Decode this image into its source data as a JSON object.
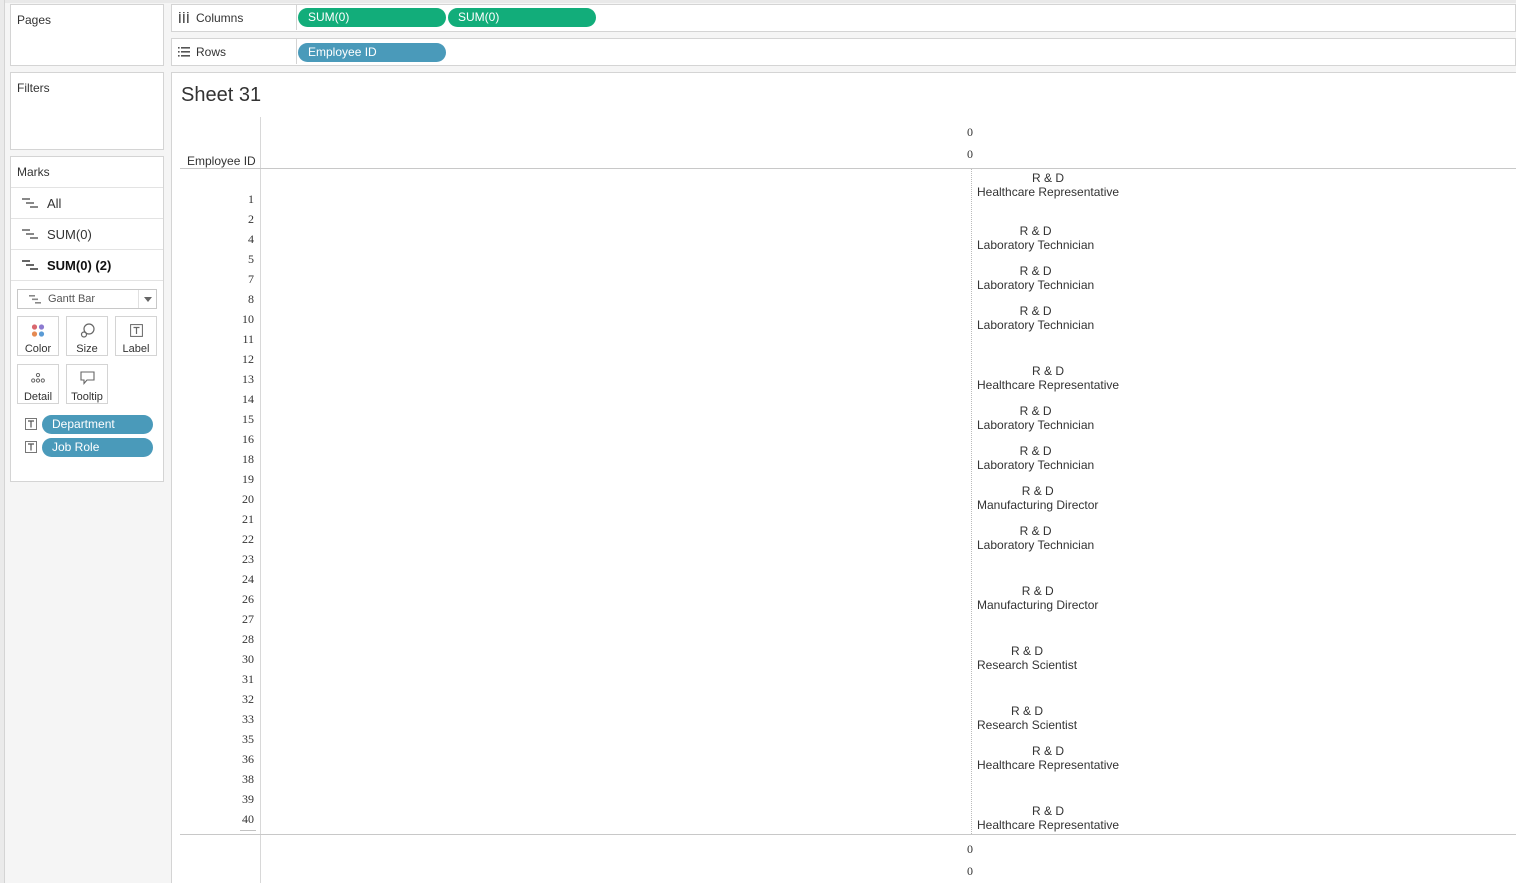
{
  "pages_card": {
    "title": "Pages"
  },
  "filters_card": {
    "title": "Filters"
  },
  "marks_card": {
    "title": "Marks",
    "rows": [
      {
        "label": "All"
      },
      {
        "label": "SUM(0)"
      },
      {
        "label": "SUM(0) (2)"
      }
    ],
    "mark_type": "Gantt Bar",
    "buttons": {
      "color": "Color",
      "size": "Size",
      "label": "Label",
      "detail": "Detail",
      "tooltip": "Tooltip"
    },
    "fields": [
      {
        "label": "Department",
        "type_icon": "T"
      },
      {
        "label": "Job Role",
        "type_icon": "T"
      }
    ]
  },
  "columns_shelf": {
    "label": "Columns",
    "pills": [
      "SUM(0)",
      "SUM(0)"
    ]
  },
  "rows_shelf": {
    "label": "Rows",
    "pills": [
      "Employee ID"
    ]
  },
  "sheet": {
    "title": "Sheet 31",
    "row_header": "Employee ID",
    "top_axis": [
      "0",
      "0"
    ],
    "bottom_axis": [
      "0",
      "0"
    ],
    "employee_ids": [
      "1",
      "2",
      "4",
      "5",
      "7",
      "8",
      "10",
      "11",
      "12",
      "13",
      "14",
      "15",
      "16",
      "18",
      "19",
      "20",
      "21",
      "22",
      "23",
      "24",
      "26",
      "27",
      "28",
      "30",
      "31",
      "32",
      "33",
      "35",
      "36",
      "38",
      "39",
      "40"
    ],
    "mark_labels": [
      {
        "department": "R & D",
        "role": "Healthcare Representative"
      },
      {
        "department": "R & D",
        "role": "Laboratory Technician"
      },
      {
        "department": "R & D",
        "role": "Laboratory Technician"
      },
      {
        "department": "R & D",
        "role": "Laboratory Technician"
      },
      {
        "department": "R & D",
        "role": "Healthcare Representative"
      },
      {
        "department": "R & D",
        "role": "Laboratory Technician"
      },
      {
        "department": "R & D",
        "role": "Laboratory Technician"
      },
      {
        "department": "R & D",
        "role": "Manufacturing Director"
      },
      {
        "department": "R & D",
        "role": "Laboratory Technician"
      },
      {
        "department": "R & D",
        "role": "Manufacturing Director"
      },
      {
        "department": "R & D",
        "role": "Research Scientist"
      },
      {
        "department": "R & D",
        "role": "Research Scientist"
      },
      {
        "department": "R & D",
        "role": "Healthcare Representative"
      },
      {
        "department": "R & D",
        "role": "Healthcare Representative"
      }
    ]
  },
  "colors": {
    "measure_pill": "#12ad7a",
    "dimension_pill": "#4a9aba"
  }
}
